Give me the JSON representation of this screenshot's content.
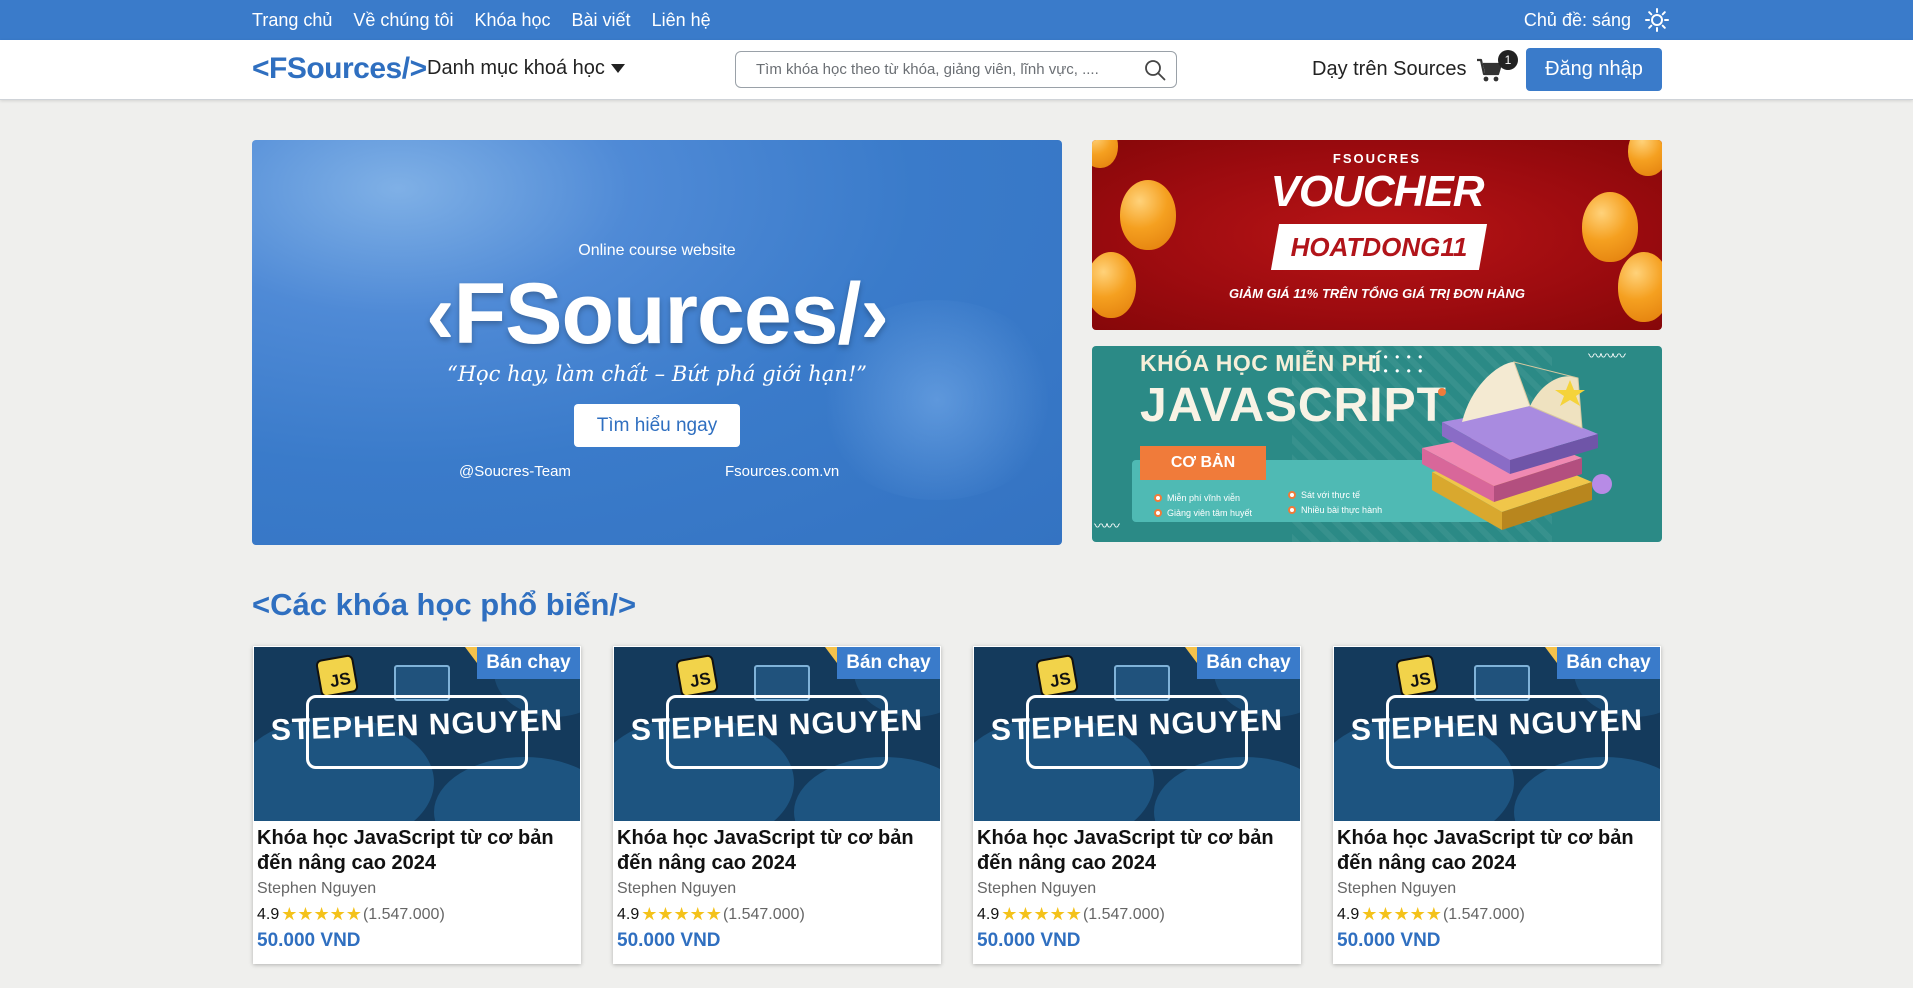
{
  "topbar": {
    "nav": [
      "Trang chủ",
      "Về chúng tôi",
      "Khóa học",
      "Bài viết",
      "Liên hệ"
    ],
    "theme_label": "Chủ đề: sáng",
    "theme_icon": "sun-icon",
    "bg_color": "#3a7bca"
  },
  "header": {
    "logo": "<FSources/>",
    "catalog_label": "Danh mục khoá học",
    "search_placeholder": "Tìm khóa học theo từ khóa, giảng viên, lĩnh vực, ....",
    "teach_label": "Dạy trên Sources",
    "cart_count": "1",
    "login_label": "Đăng nhập"
  },
  "hero": {
    "subtitle": "Online course website",
    "title": "‹FSources/›",
    "quote": "“Học hay, làm chất – Bứt phá giới hạn!”",
    "cta_label": "Tìm hiểu ngay",
    "team": "@Soucres-Team",
    "site": "Fsources.com.vn"
  },
  "voucher": {
    "brand": "FSOUCRES",
    "title": "VOUCHER",
    "code": "HOATDONG11",
    "desc": "GIẢM GIÁ 11% TRÊN TỔNG GIÁ TRỊ ĐƠN HÀNG"
  },
  "js_banner": {
    "line1": "KHÓA HỌC MIỄN PHÍ",
    "line2": "JAVASCRIPT",
    "tag": "CƠ BẢN",
    "features": [
      "Miễn phí vĩnh viễn",
      "Giảng viên tâm huyết",
      "Sát với thực tế",
      "Nhiều bài thực hành"
    ]
  },
  "section": {
    "title": "<Các khóa học phổ biến/>"
  },
  "courses": [
    {
      "badge": "Bán chạy",
      "thumb_name": "STEPHEN NGUYEN",
      "thumb_js": "JS",
      "title": "Khóa học JavaScript từ cơ bản đến nâng cao 2024",
      "author": "Stephen Nguyen",
      "rating": "4.9",
      "stars": "★★★★★",
      "reviews": "(1.547.000)",
      "price": "50.000 VND"
    },
    {
      "badge": "Bán chạy",
      "thumb_name": "STEPHEN NGUYEN",
      "thumb_js": "JS",
      "title": "Khóa học JavaScript từ cơ bản đến nâng cao 2024",
      "author": "Stephen Nguyen",
      "rating": "4.9",
      "stars": "★★★★★",
      "reviews": "(1.547.000)",
      "price": "50.000 VND"
    },
    {
      "badge": "Bán chạy",
      "thumb_name": "STEPHEN NGUYEN",
      "thumb_js": "JS",
      "title": "Khóa học JavaScript từ cơ bản đến nâng cao 2024",
      "author": "Stephen Nguyen",
      "rating": "4.9",
      "stars": "★★★★★",
      "reviews": "(1.547.000)",
      "price": "50.000 VND"
    },
    {
      "badge": "Bán chạy",
      "thumb_name": "STEPHEN NGUYEN",
      "thumb_js": "JS",
      "title": "Khóa học JavaScript từ cơ bản đến nâng cao 2024",
      "author": "Stephen Nguyen",
      "rating": "4.9",
      "stars": "★★★★★",
      "reviews": "(1.547.000)",
      "price": "50.000 VND"
    }
  ]
}
